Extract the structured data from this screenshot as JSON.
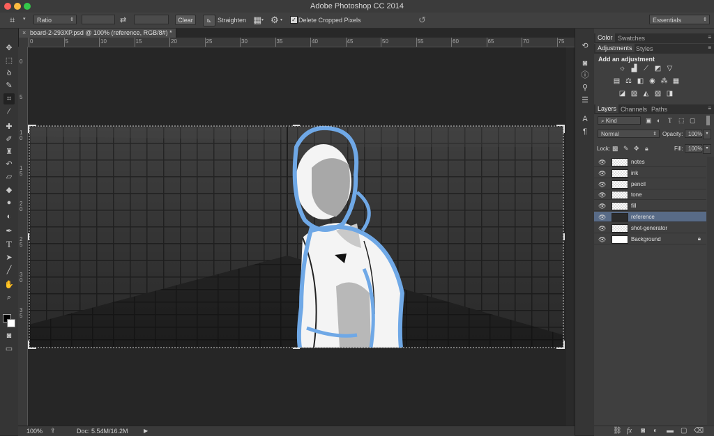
{
  "window": {
    "title": "Adobe Photoshop CC 2014"
  },
  "options_bar": {
    "ratio_select": "Ratio",
    "clear_label": "Clear",
    "straighten_label": "Straighten",
    "delete_cropped_label": "Delete Cropped Pixels",
    "delete_cropped_checked": true,
    "workspace_select": "Essentials"
  },
  "document": {
    "tab_title": "board-2-293XP.psd @ 100% (reference, RGB/8#) *",
    "zoom": "100%",
    "doc_size": "Doc: 5.54M/16.2M"
  },
  "rulers": {
    "horizontal": [
      "0",
      "5",
      "10",
      "15",
      "20",
      "25",
      "30",
      "35",
      "40",
      "45",
      "50",
      "55",
      "60",
      "65",
      "70",
      "75"
    ],
    "vertical": [
      "0",
      "5",
      "1 0",
      "1 5",
      "2 0",
      "2 5",
      "3 0",
      "3 5"
    ]
  },
  "panels": {
    "top_tabs": [
      "Color",
      "Swatches"
    ],
    "adjust_tabs": [
      "Adjustments",
      "Styles"
    ],
    "add_adjustment_label": "Add an adjustment",
    "layer_tabs": [
      "Layers",
      "Channels",
      "Paths"
    ],
    "kind_filter": "Kind",
    "blend_mode": "Normal",
    "opacity_label": "Opacity:",
    "opacity_value": "100%",
    "lock_label": "Lock:",
    "fill_label": "Fill:",
    "fill_value": "100%",
    "layers": [
      {
        "name": "notes",
        "visible": true,
        "selected": false
      },
      {
        "name": "ink",
        "visible": true,
        "selected": false
      },
      {
        "name": "pencil",
        "visible": true,
        "selected": false
      },
      {
        "name": "tone",
        "visible": true,
        "selected": false
      },
      {
        "name": "fill",
        "visible": true,
        "selected": false
      },
      {
        "name": "reference",
        "visible": true,
        "selected": true
      },
      {
        "name": "shot-generator",
        "visible": true,
        "selected": false
      },
      {
        "name": "Background",
        "visible": true,
        "selected": false,
        "locked": true
      }
    ]
  },
  "colors": {
    "accent_selected_layer": "#586b87",
    "sketch_blue": "#6fa8e6"
  }
}
